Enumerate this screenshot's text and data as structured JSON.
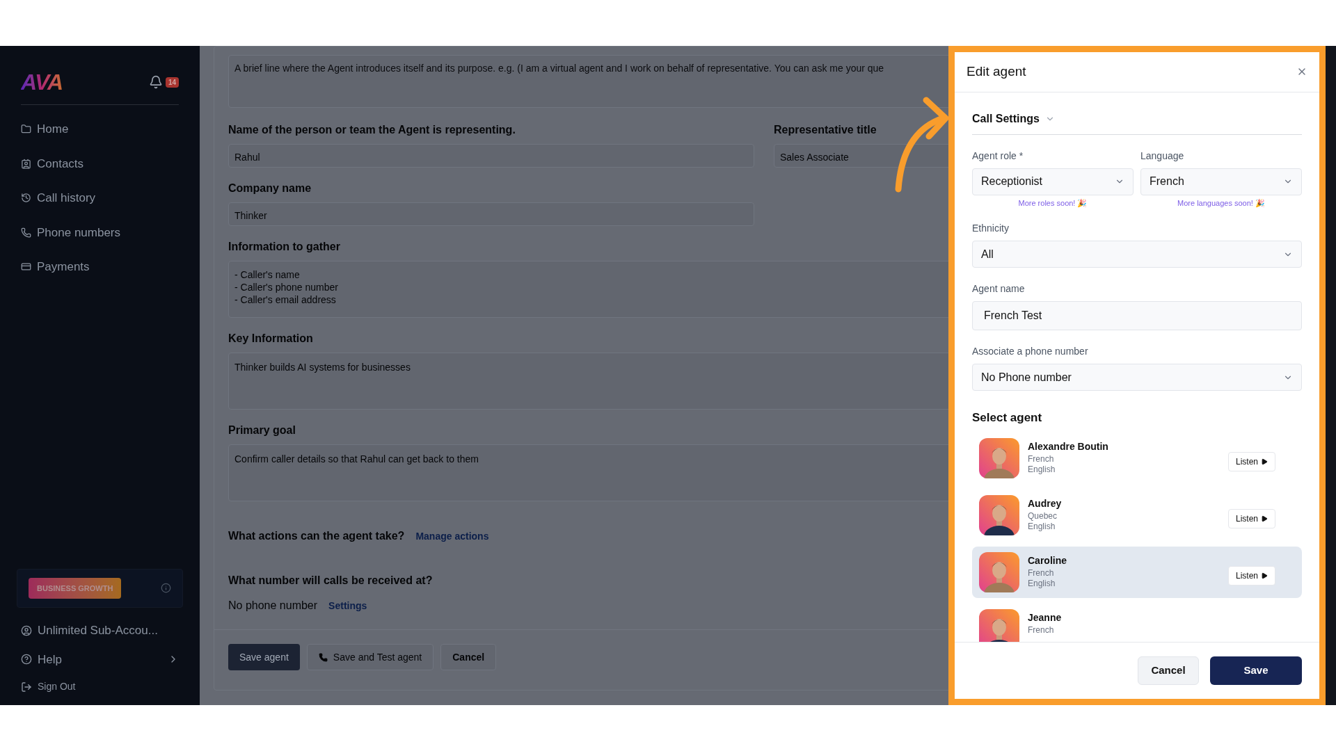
{
  "sidebar": {
    "logo": "AVA",
    "notifications": "14",
    "items": [
      {
        "label": "Home"
      },
      {
        "label": "Contacts"
      },
      {
        "label": "Call history"
      },
      {
        "label": "Phone numbers"
      },
      {
        "label": "Payments"
      }
    ],
    "plan_badge": "BUSINESS GROWTH",
    "footer": [
      {
        "label": "Unlimited Sub-Accou...",
        "chevron": false
      },
      {
        "label": "Help",
        "chevron": true
      },
      {
        "label": "Sign Out",
        "chevron": false
      }
    ]
  },
  "form": {
    "intro_placeholder": "A brief line where the Agent introduces itself and its purpose. e.g. (I am a virtual agent and I work on behalf of representative. You can ask me your que",
    "representing": {
      "label": "Name of the person or team the Agent is representing.",
      "value": "Rahul"
    },
    "title": {
      "label": "Representative title",
      "value": "Sales Associate"
    },
    "company": {
      "label": "Company name",
      "value": "Thinker"
    },
    "gather": {
      "label": "Information to gather",
      "lines": [
        "- Caller's name",
        "- Caller's phone number",
        "- Caller's email address"
      ]
    },
    "key_info": {
      "label": "Key Information",
      "value": "Thinker builds AI systems for businesses"
    },
    "goal": {
      "label": "Primary goal",
      "value": "Confirm caller details so that Rahul can get back to them"
    },
    "actions": {
      "label": "What actions can the agent take?",
      "link": "Manage actions"
    },
    "number": {
      "label": "What number will calls be received at?",
      "value": "No phone number",
      "link": "Settings"
    },
    "buttons": [
      {
        "label": "Save agent",
        "kind": "primary"
      },
      {
        "label": "Save and Test agent",
        "kind": "phone"
      },
      {
        "label": "Cancel",
        "kind": "plain"
      }
    ]
  },
  "dialog": {
    "title": "Edit agent",
    "section": {
      "label": "Call Settings",
      "expanded": true
    },
    "role": {
      "label": "Agent role *",
      "value": "Receptionist",
      "hint": "More roles soon! 🎉"
    },
    "language": {
      "label": "Language",
      "value": "French",
      "hint": "More languages soon! 🎉"
    },
    "ethnicity": {
      "label": "Ethnicity",
      "value": "All"
    },
    "agent_name": {
      "label": "Agent name",
      "value": "French Test"
    },
    "phone": {
      "label": "Associate a phone number",
      "value": "No Phone number"
    },
    "select_label": "Select agent",
    "agents": [
      {
        "name": "Alexandre Boutin",
        "languages": [
          "French",
          "English"
        ],
        "listen": "Listen",
        "selected": false
      },
      {
        "name": "Audrey",
        "languages": [
          "Quebec",
          "English"
        ],
        "listen": "Listen",
        "selected": false
      },
      {
        "name": "Caroline",
        "languages": [
          "French",
          "English"
        ],
        "listen": "Listen",
        "selected": true
      },
      {
        "name": "Jeanne",
        "languages": [
          "French"
        ],
        "selected": false
      }
    ],
    "buttons": [
      {
        "label": "Cancel",
        "kind": "secondary"
      },
      {
        "label": "Save",
        "kind": "primary"
      }
    ]
  }
}
